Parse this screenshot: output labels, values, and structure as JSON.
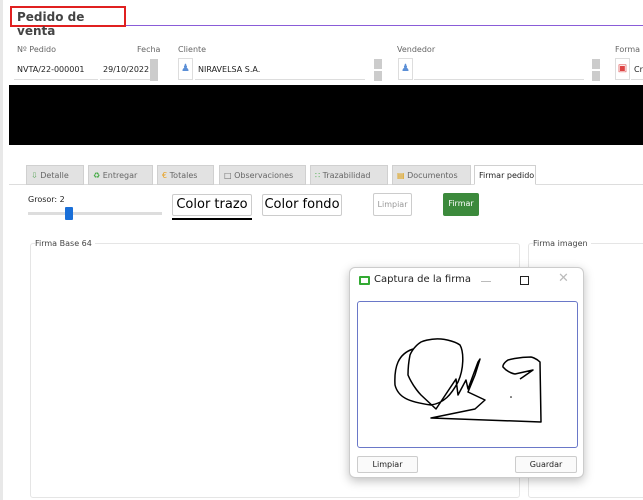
{
  "header": {
    "title": "Pedido de venta"
  },
  "form": {
    "order_no_label": "Nº Pedido",
    "order_no": "NVTA/22-000001",
    "date_label": "Fecha",
    "date": "29/10/2022",
    "client_label": "Cliente",
    "client": "NIRAVELSA S.A.",
    "seller_label": "Vendedor",
    "seller": "",
    "payment_label": "Forma",
    "payment": "Cr"
  },
  "tabs": [
    {
      "label": "Detalle",
      "icon": "download-icon"
    },
    {
      "label": "Entregar",
      "icon": "recycle-icon"
    },
    {
      "label": "Totales",
      "icon": "euro-icon"
    },
    {
      "label": "Observaciones",
      "icon": "document-icon"
    },
    {
      "label": "Trazabilidad",
      "icon": "arrows-icon"
    },
    {
      "label": "Documentos",
      "icon": "folder-icon"
    },
    {
      "label": "Firmar pedido",
      "active": true
    }
  ],
  "sign": {
    "thickness_label": "Grosor: 2",
    "thickness": 2,
    "stroke_color_label": "Color trazo",
    "stroke_color": "#000000",
    "bg_color_label": "Color fondo",
    "clear_label": "Limpiar",
    "sign_label": "Firmar",
    "base64_label": "Firma Base 64",
    "image_label": "Firma imagen"
  },
  "dialog": {
    "title": "Captura de la firma",
    "clear_label": "Limpiar",
    "save_label": "Guardar"
  },
  "colors": {
    "accent": "#8a5cd8",
    "title_border": "#e02020",
    "sign_button": "#3c8a3c"
  }
}
